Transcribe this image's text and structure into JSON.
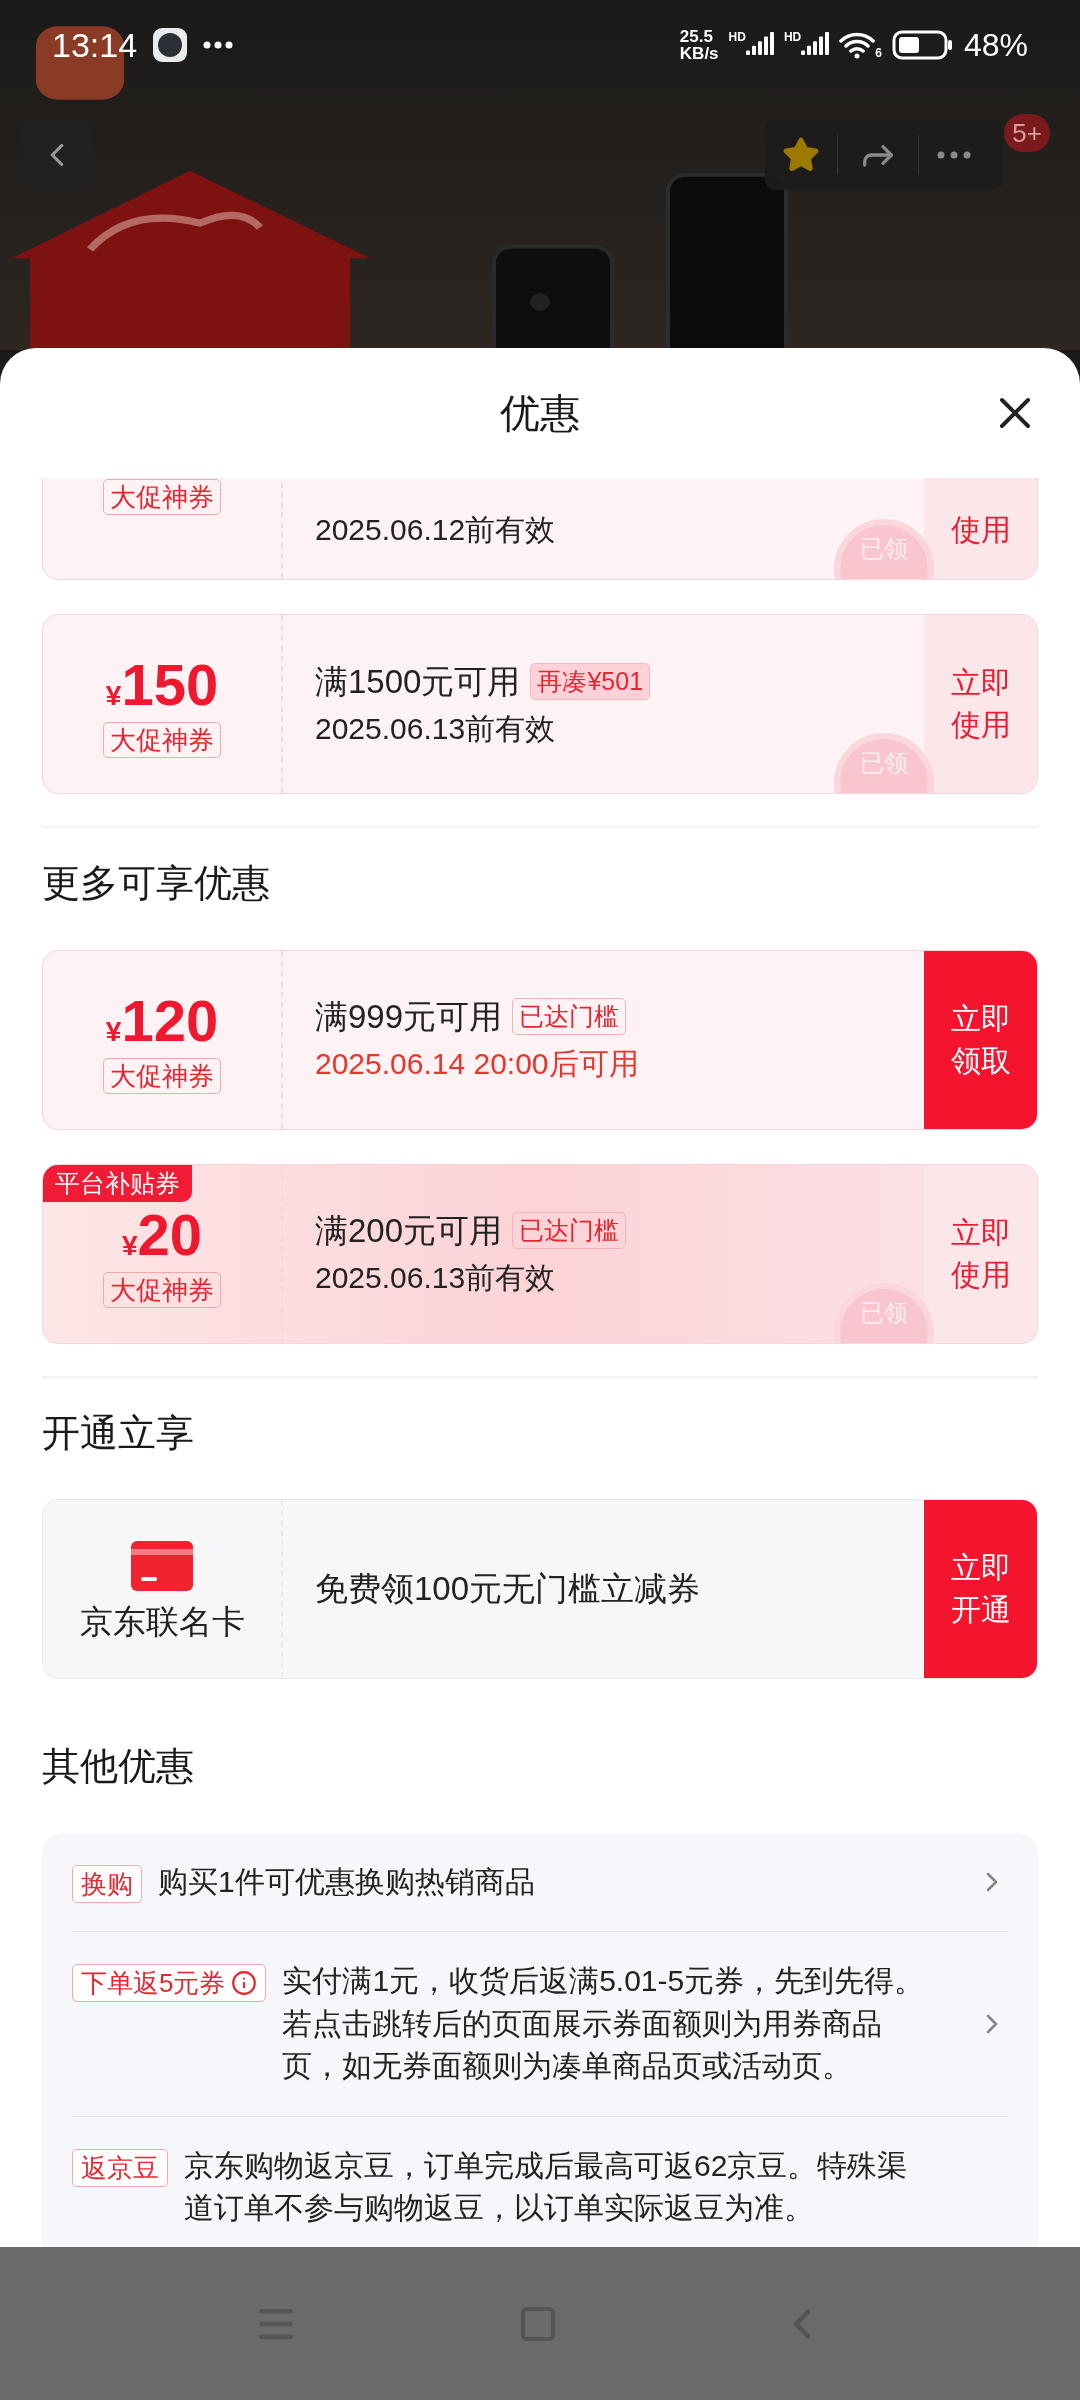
{
  "status_bar": {
    "time": "13:14",
    "speed_value": "25.5",
    "speed_unit": "KB/s",
    "network_labels": [
      "HD",
      "HD"
    ],
    "wifi_label": "6",
    "battery": "48%"
  },
  "top_actions": {
    "favorited": true,
    "badge": "5+"
  },
  "sheet": {
    "title": "优惠"
  },
  "coupon_groups": [
    {
      "coupons": [
        {
          "tag": "大促神券",
          "validity": "2025.06.12前有效",
          "validity_highlight": false,
          "action_lines": [
            "使用"
          ],
          "action_filled": false,
          "claimed": true,
          "stamp": "已领",
          "cut_top": true
        },
        {
          "currency": "¥",
          "amount": "150",
          "tag": "大促神券",
          "condition": "满1500元可用",
          "badge": "再凑¥501",
          "badge_filled": true,
          "validity": "2025.06.13前有效",
          "validity_highlight": false,
          "action_lines": [
            "立即",
            "使用"
          ],
          "action_filled": false,
          "claimed": true,
          "stamp": "已领",
          "cut_top": false
        }
      ]
    },
    {
      "heading": "更多可享优惠",
      "coupons": [
        {
          "featured": false,
          "currency": "¥",
          "amount": "120",
          "tag": "大促神券",
          "condition": "满999元可用",
          "badge": "已达门槛",
          "badge_filled": false,
          "validity": "2025.06.14 20:00后可用",
          "validity_highlight": true,
          "action_lines": [
            "立即",
            "领取"
          ],
          "action_filled": true,
          "claimed": false,
          "cut_top": false
        },
        {
          "corner_label": "平台补贴券",
          "featured": true,
          "currency": "¥",
          "amount": "20",
          "tag": "大促神券",
          "condition": "满200元可用",
          "badge": "已达门槛",
          "badge_filled": false,
          "validity": "2025.06.13前有效",
          "validity_highlight": false,
          "action_lines": [
            "立即",
            "使用"
          ],
          "action_filled": false,
          "claimed": true,
          "stamp": "已领",
          "cut_top": false
        }
      ]
    }
  ],
  "card_offer": {
    "heading": "开通立享",
    "card_name": "京东联名卡",
    "text": "免费领100元无门槛立减券",
    "action_lines": [
      "立即",
      "开通"
    ]
  },
  "other_offers": {
    "heading": "其他优惠",
    "items": [
      {
        "tag": "换购",
        "text": "购买1件可优惠换购热销商品",
        "info": false,
        "chevron": true
      },
      {
        "tag": "下单返5元券",
        "text": "实付满1元，收货后返满5.01-5元券，先到先得。若点击跳转后的页面展示券面额则为用券商品页，如无券面额则为凑单商品页或活动页。",
        "info": true,
        "chevron": true
      },
      {
        "tag": "返京豆",
        "text": "京东购物返京豆，订单完成后最高可返62京豆。特殊渠道订单不参与购物返豆，以订单实际返豆为准。",
        "info": false,
        "chevron": false
      }
    ]
  }
}
